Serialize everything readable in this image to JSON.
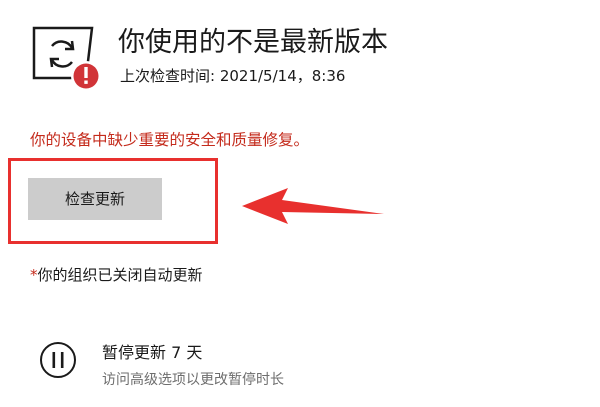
{
  "status": {
    "icon": "update-error-icon",
    "badge_icon": "error-badge-icon",
    "title": "你使用的不是最新版本",
    "last_checked": "上次检查时间: 2021/5/14，8:36"
  },
  "warning": "你的设备中缺少重要的安全和质量修复。",
  "check_button": {
    "label": "检查更新"
  },
  "annotation": {
    "color": "#e8302e",
    "box": "highlight-box",
    "arrow": "pointer-arrow"
  },
  "policy_note": {
    "mark": "*",
    "text": "你的组织已关闭自动更新"
  },
  "pause": {
    "icon": "pause-icon",
    "title": "暂停更新 7 天",
    "subtitle": "访问高级选项以更改暂停时长"
  },
  "colors": {
    "warning_text": "#c42b1c",
    "button_bg": "#cccccc",
    "error_badge": "#d13438",
    "secondary_text": "#6e6e6e"
  }
}
